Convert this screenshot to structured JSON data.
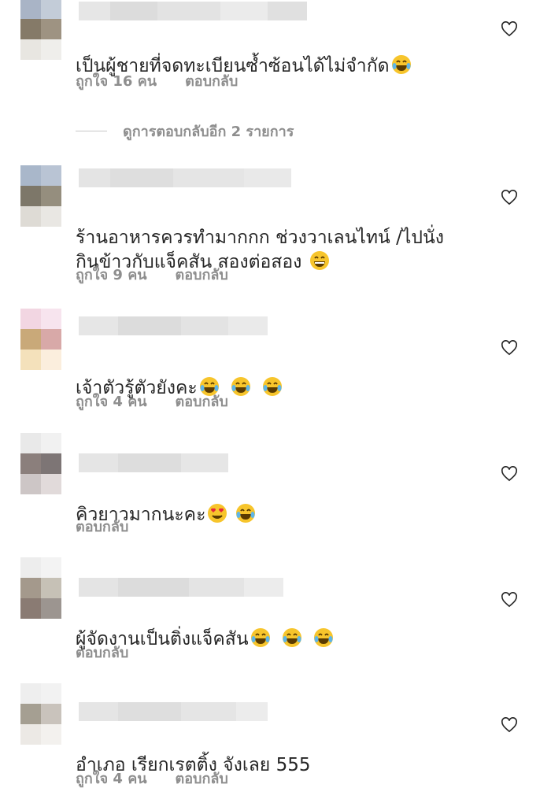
{
  "comments": [
    {
      "text": "เป็นผู้ชายที่จดทะเบียนซ้ำซ้อนได้ไม่จำกัด",
      "emojis": [
        "joy"
      ],
      "likes": "ถูกใจ 16 คน",
      "reply": "ตอบกลับ"
    },
    {
      "text": "ร้านอาหารควรทำมากกก ช่วงวาเลนไทน์ /ไปนั่ง\nกินข้าวกับแจ็คสัน สองต่อสอง",
      "emojis": [
        "grin"
      ],
      "likes": "ถูกใจ 9 คน",
      "reply": "ตอบกลับ"
    },
    {
      "text": "เจ้าตัวรู้ตัวยังคะ",
      "emojis": [
        "joy",
        "joy",
        "joy"
      ],
      "likes": "ถูกใจ 4 คน",
      "reply": "ตอบกลับ"
    },
    {
      "text": "คิวยาวมากนะคะ",
      "emojis": [
        "heart-eyes",
        "joy"
      ],
      "likes": "",
      "reply": "ตอบกลับ"
    },
    {
      "text": "ผู้จัดงานเป็นติ่งแจ็คสัน",
      "emojis": [
        "joy",
        "joy",
        "joy"
      ],
      "likes": "",
      "reply": "ตอบกลับ"
    },
    {
      "text": "อำเภอ เรียกเรตติ้ง จังเลย 555",
      "emojis": [],
      "likes": "ถูกใจ 4 คน",
      "reply": "ตอบกลับ"
    }
  ],
  "view_replies": "ดูการตอบกลับอีก 2 รายการ",
  "icons": {
    "like": "heart-outline-icon"
  },
  "colors": {
    "text": "#262626",
    "meta": "#8e8e8e"
  }
}
